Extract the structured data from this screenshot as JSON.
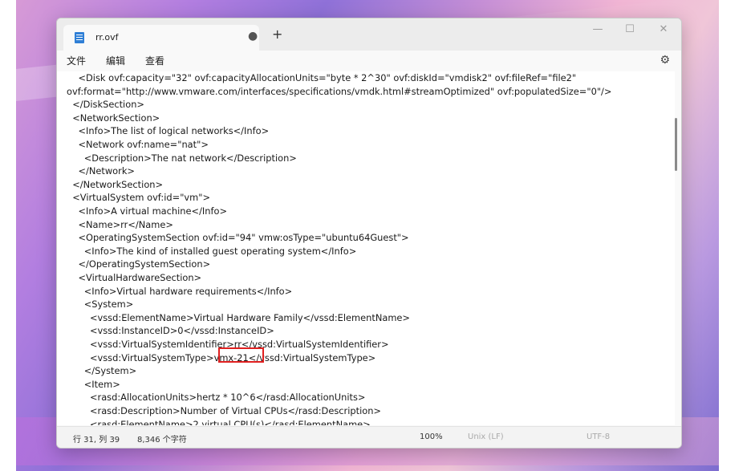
{
  "app": {
    "tab_title": "rr.ovf",
    "tab_modified_dot": "●",
    "add_tab": "+",
    "controls": {
      "minimize": "—",
      "maximize": "☐",
      "close": "✕"
    }
  },
  "menu": {
    "file": "文件",
    "edit": "编辑",
    "view": "查看",
    "settings_icon": "⚙"
  },
  "editor": {
    "lines": [
      "    <Disk ovf:capacity=\"32\" ovf:capacityAllocationUnits=\"byte * 2^30\" ovf:diskId=\"vmdisk2\" ovf:fileRef=\"file2\"",
      "ovf:format=\"http://www.vmware.com/interfaces/specifications/vmdk.html#streamOptimized\" ovf:populatedSize=\"0\"/>",
      "  </DiskSection>",
      "  <NetworkSection>",
      "    <Info>The list of logical networks</Info>",
      "    <Network ovf:name=\"nat\">",
      "      <Description>The nat network</Description>",
      "    </Network>",
      "  </NetworkSection>",
      "  <VirtualSystem ovf:id=\"vm\">",
      "    <Info>A virtual machine</Info>",
      "    <Name>rr</Name>",
      "    <OperatingSystemSection ovf:id=\"94\" vmw:osType=\"ubuntu64Guest\">",
      "      <Info>The kind of installed guest operating system</Info>",
      "    </OperatingSystemSection>",
      "    <VirtualHardwareSection>",
      "      <Info>Virtual hardware requirements</Info>",
      "      <System>",
      "        <vssd:ElementName>Virtual Hardware Family</vssd:ElementName>",
      "        <vssd:InstanceID>0</vssd:InstanceID>",
      "        <vssd:VirtualSystemIdentifier>rr</vssd:VirtualSystemIdentifier>",
      "        <vssd:VirtualSystemType>vmx-21</vssd:VirtualSystemType>",
      "      </System>",
      "      <Item>",
      "        <rasd:AllocationUnits>hertz * 10^6</rasd:AllocationUnits>",
      "        <rasd:Description>Number of Virtual CPUs</rasd:Description>",
      "        <rasd:ElementName>2 virtual CPU(s)</rasd:ElementName>"
    ],
    "highlight_color": "#e02020"
  },
  "status": {
    "position": "行 31, 列 39",
    "char_count": "8,346 个字符",
    "zoom": "100%",
    "line_ending": "Unix (LF)",
    "encoding": "UTF-8"
  }
}
